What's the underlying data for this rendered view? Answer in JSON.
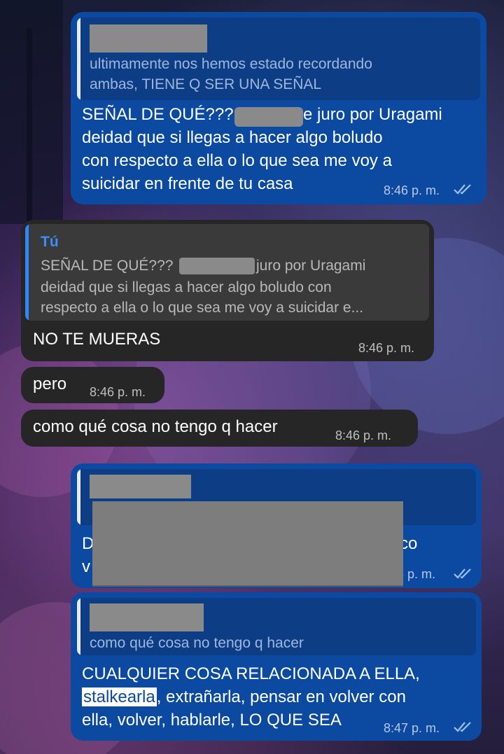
{
  "messages": [
    {
      "id": "m1",
      "reply_quote": "ultimamente nos hemos estado recordando\nambas, TIENE Q SER UNA SEÑAL",
      "line1_a": "SEÑAL DE QUÉ???",
      "line1_b": "e juro por Uragami",
      "line2": "deidad que si llegas a hacer algo boludo",
      "line3": "con respecto a ella o lo que sea me voy a",
      "line4": "suicidar en frente de tu casa",
      "time": "8:46 p. m."
    },
    {
      "id": "m2",
      "reply_sender": "Tú",
      "reply_line1_a": "SEÑAL DE QUÉ???",
      "reply_line1_b": "juro por Uragami",
      "reply_line2": "deidad que si llegas a hacer algo boludo con",
      "reply_line3": "respecto a ella o lo que sea me voy a suicidar e...",
      "text": "NO TE MUERAS",
      "time": "8:46 p. m."
    },
    {
      "id": "m3",
      "text": "pero",
      "time": "8:46 p. m."
    },
    {
      "id": "m4",
      "text": "como qué cosa no tengo q hacer",
      "time": "8:46 p. m."
    },
    {
      "id": "m5",
      "text_left_1": "D",
      "text_left_2": "v",
      "text_right": "co",
      "time": "6 p. m."
    },
    {
      "id": "m6",
      "reply_quote": "como qué cosa no tengo q hacer",
      "line1": "CUALQUIER COSA RELACIONADA A ELLA,",
      "line2_highlight": "stalkearla",
      "line2_rest": ", extrañarla, pensar en volver con",
      "line3": "ella, volver, hablarle, LO QUE SEA",
      "time": "8:47 p. m."
    }
  ],
  "colors": {
    "outgoing_bubble": "#0b4aa0",
    "incoming_bubble": "#262626",
    "reply_accent": "#2f86ff"
  },
  "icons": [
    "double-check-icon"
  ]
}
